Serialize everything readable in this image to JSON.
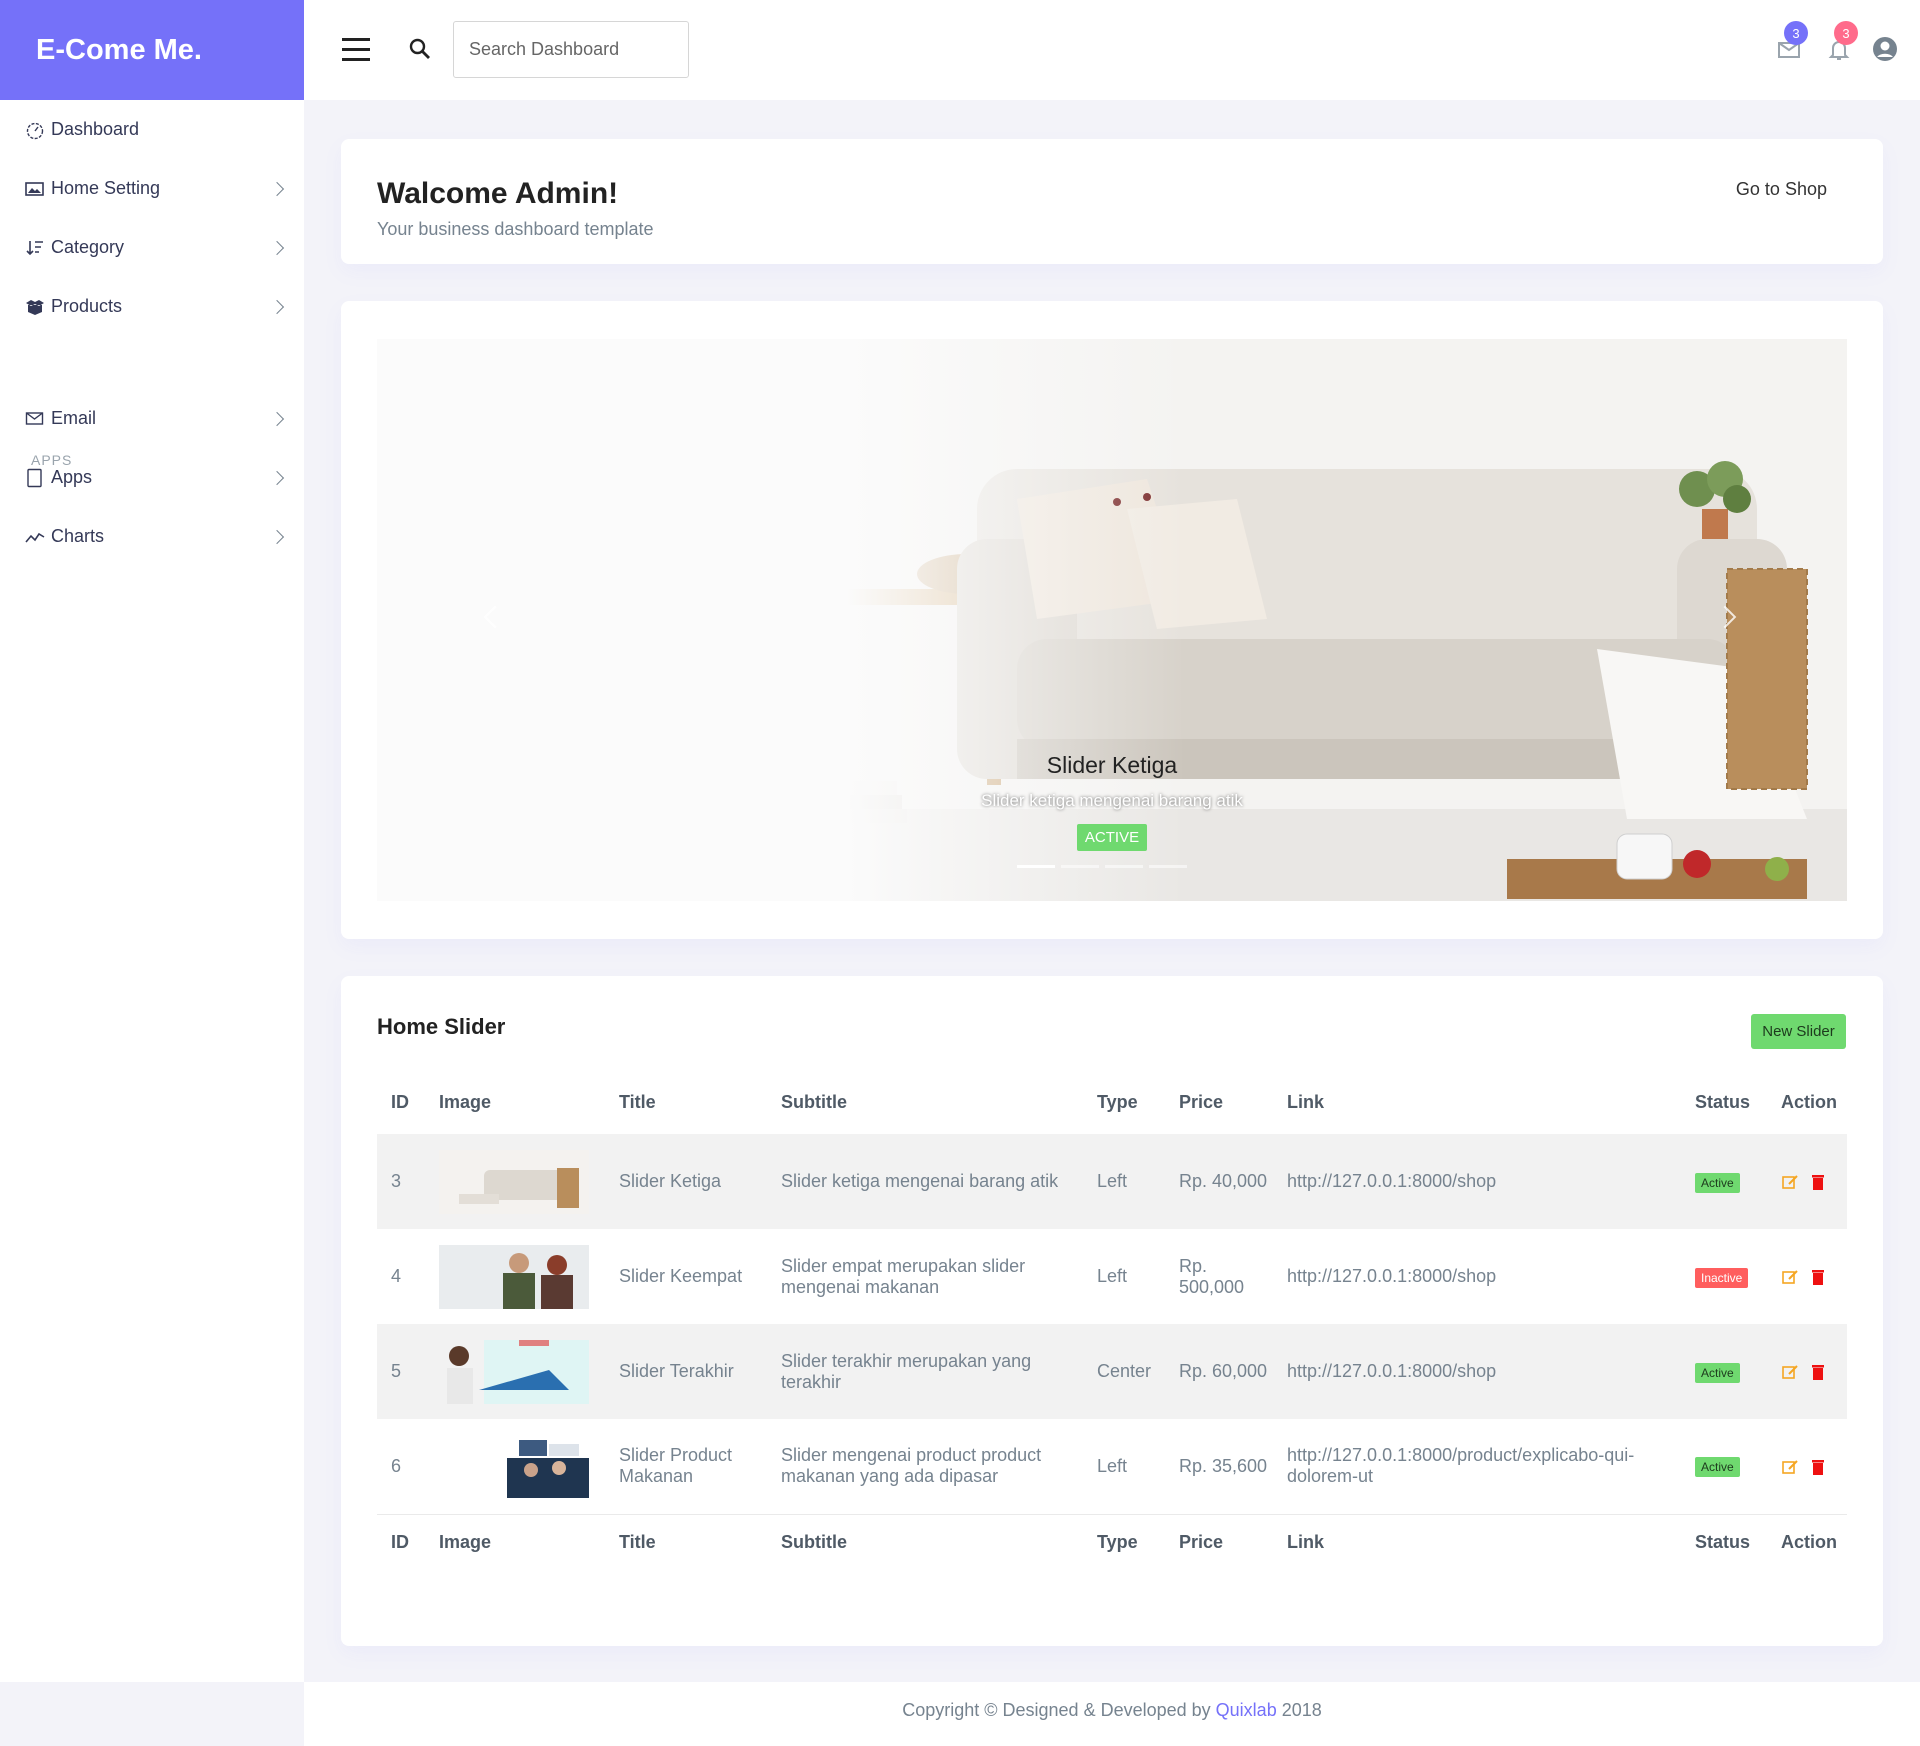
{
  "brand": "E-Come Me.",
  "search": {
    "placeholder": "Search Dashboard"
  },
  "header": {
    "mail_count": "3",
    "notif_count": "3"
  },
  "colors": {
    "brand": "#7571f9",
    "active": "#6fd96f",
    "inactive": "#ff5e5e",
    "notif": "#ff6b8b"
  },
  "sidebar": {
    "items": [
      {
        "label": "Dashboard",
        "icon": "speedometer-icon"
      },
      {
        "label": "Home Setting",
        "icon": "image-icon"
      },
      {
        "label": "Category",
        "icon": "sort-icon"
      },
      {
        "label": "Products",
        "icon": "box-icon"
      }
    ],
    "section": "APPS",
    "apps": [
      {
        "label": "Email",
        "icon": "envelope-icon"
      },
      {
        "label": "Apps",
        "icon": "tablet-icon"
      },
      {
        "label": "Charts",
        "icon": "chart-line-icon"
      }
    ]
  },
  "welcome": {
    "title": "Walcome Admin!",
    "subtitle": "Your business dashboard template",
    "go_shop": "Go to Shop"
  },
  "carousel": {
    "title": "Slider Ketiga",
    "subtitle": "Slider ketiga mengenai barang atik",
    "status": "ACTIVE"
  },
  "slider_table": {
    "title": "Home Slider",
    "new_button": "New Slider",
    "columns": [
      "ID",
      "Image",
      "Title",
      "Subtitle",
      "Type",
      "Price",
      "Link",
      "Status",
      "Action"
    ],
    "rows": [
      {
        "id": "3",
        "title": "Slider Ketiga",
        "subtitle": "Slider ketiga mengenai barang atik",
        "type": "Left",
        "price": "Rp. 40,000",
        "link": "http://127.0.0.1:8000/shop",
        "status": "Active"
      },
      {
        "id": "4",
        "title": "Slider Keempat",
        "subtitle": "Slider empat merupakan slider mengenai makanan",
        "type": "Left",
        "price": "Rp. 500,000",
        "link": "http://127.0.0.1:8000/shop",
        "status": "Inactive"
      },
      {
        "id": "5",
        "title": "Slider Terakhir",
        "subtitle": "Slider terakhir merupakan yang terakhir",
        "type": "Center",
        "price": "Rp. 60,000",
        "link": "http://127.0.0.1:8000/shop",
        "status": "Active"
      },
      {
        "id": "6",
        "title": "Slider Product Makanan",
        "subtitle": "Slider mengenai product product makanan yang ada dipasar",
        "type": "Left",
        "price": "Rp. 35,600",
        "link": "http://127.0.0.1:8000/product/explicabo-qui-dolorem-ut",
        "status": "Active"
      }
    ]
  },
  "footer": {
    "prefix": "Copyright © Designed & Developed by",
    "link": "Quixlab",
    "year": "2018"
  }
}
